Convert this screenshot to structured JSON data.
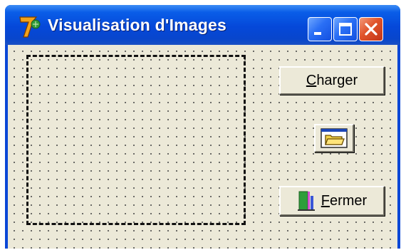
{
  "window": {
    "title": "Visualisation d'Images",
    "icon": "windev-7-icon",
    "controls": [
      "minimize-icon",
      "maximize-icon",
      "close-icon"
    ]
  },
  "buttons": {
    "charger": {
      "mnemonic": "C",
      "rest": "harger"
    },
    "fermer": {
      "mnemonic": "F",
      "rest": "ermer",
      "icon": "door-exit-icon"
    },
    "folder": {
      "icon": "open-folder-icon"
    }
  },
  "colors": {
    "titlebar": "#0548d9",
    "client_bg": "#ece9d8",
    "close_button": "#e0532a"
  }
}
